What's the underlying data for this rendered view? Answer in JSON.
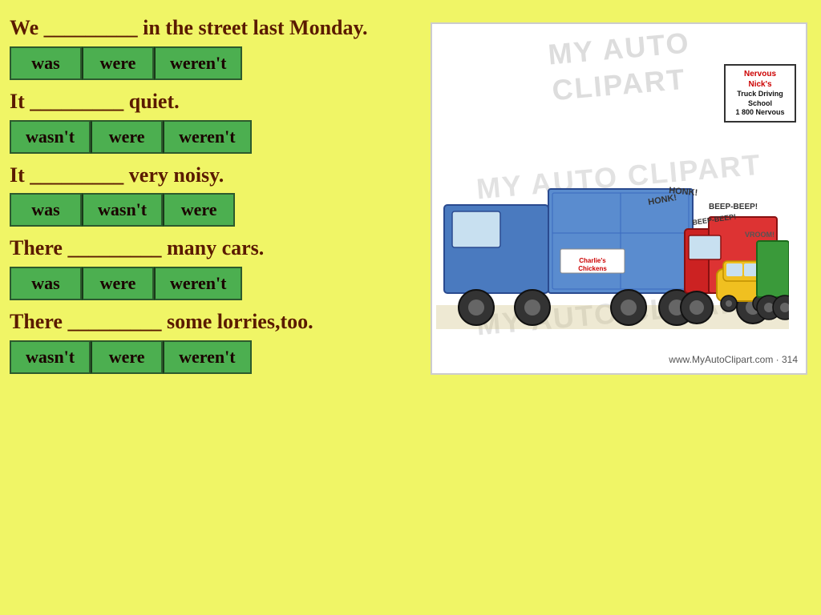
{
  "background_color": "#f0f566",
  "questions": [
    {
      "id": "q1",
      "text": "We _________ in the street last Monday.",
      "options": [
        "was",
        "were",
        "weren't"
      ]
    },
    {
      "id": "q2",
      "text": "It _________ quiet.",
      "options": [
        "wasn't",
        "were",
        "weren't"
      ]
    },
    {
      "id": "q3",
      "text": "It _________ very noisy.",
      "options": [
        "was",
        "wasn't",
        "were"
      ]
    },
    {
      "id": "q4",
      "text": "There _________ many cars.",
      "options": [
        "was",
        "were",
        "weren't"
      ]
    },
    {
      "id": "q5",
      "text": "There _________ some lorries,too.",
      "options": [
        "wasn't",
        "were",
        "weren't"
      ]
    }
  ],
  "clipart": {
    "watermark_lines": [
      "MY AUTO",
      "CLIPART"
    ],
    "footer": "www.MyAutoClipart.com · 314",
    "sign": {
      "title": "Nervous Nick's",
      "line1": "Truck Driving School",
      "line2": "1 800 Nervous"
    }
  }
}
